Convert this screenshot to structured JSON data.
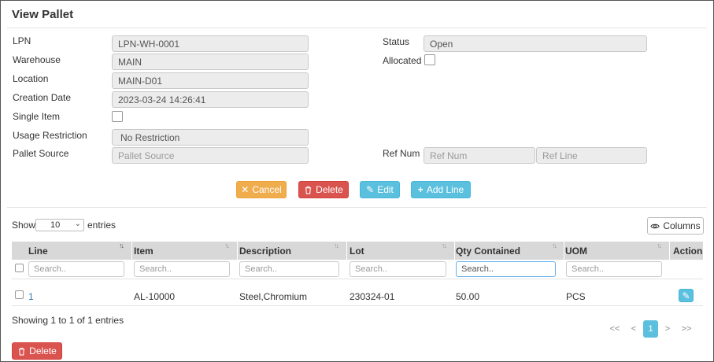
{
  "page": {
    "title": "View Pallet"
  },
  "form": {
    "lpn_label": "LPN",
    "lpn_value": "LPN-WH-0001",
    "warehouse_label": "Warehouse",
    "warehouse_value": "MAIN",
    "location_label": "Location",
    "location_value": "MAIN-D01",
    "creation_date_label": "Creation Date",
    "creation_date_value": "2023-03-24 14:26:41",
    "single_item_label": "Single Item",
    "single_item_checked": false,
    "usage_restriction_label": "Usage Restriction",
    "usage_restriction_value": "No Restriction",
    "pallet_source_label": "Pallet Source",
    "pallet_source_placeholder": "Pallet Source",
    "status_label": "Status",
    "status_value": "Open",
    "allocated_label": "Allocated",
    "allocated_checked": false,
    "ref_num_label": "Ref Num",
    "ref_num_placeholder": "Ref Num",
    "ref_line_placeholder": "Ref Line"
  },
  "actions": {
    "cancel": "Cancel",
    "delete": "Delete",
    "edit": "Edit",
    "add_line": "Add Line"
  },
  "table_controls": {
    "show_label": "Show",
    "page_size": "10",
    "entries_label": "entries",
    "columns_button": "Columns"
  },
  "table": {
    "columns": [
      "Line",
      "Item",
      "Description",
      "Lot",
      "Qty Contained",
      "UOM",
      "Action"
    ],
    "search_placeholder": "Search..",
    "rows": [
      {
        "line": "1",
        "item": "AL-10000",
        "description": "Steel,Chromium",
        "lot": "230324-01",
        "qty_contained": "50.00",
        "uom": "PCS"
      }
    ]
  },
  "footer": {
    "info": "Showing 1 to 1 of 1 entries",
    "pagination": {
      "first": "<<",
      "prev": "<",
      "current": "1",
      "next": ">",
      "last": ">>"
    },
    "delete_button": "Delete"
  },
  "colors": {
    "warning": "#f0ad4e",
    "danger": "#d9534f",
    "info": "#5bc0de",
    "link": "#337ab7"
  }
}
